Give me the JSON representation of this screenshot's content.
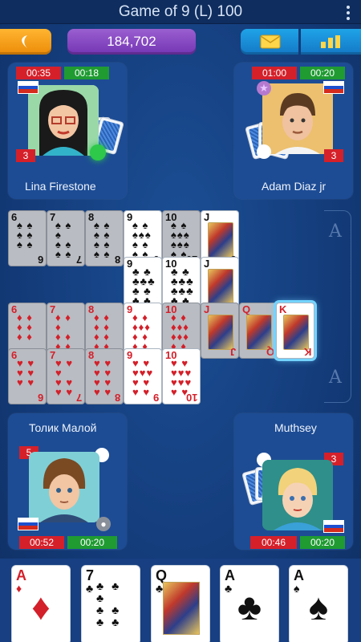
{
  "header": {
    "title": "Game of 9 (L) 100",
    "coins": "184,702"
  },
  "colors": {
    "table": "#1a4a93",
    "timer_red": "#d5202a",
    "timer_green": "#1f9b32",
    "coins": "#8048c0",
    "orange": "#f5a01c",
    "blue_button": "#1b8fdd"
  },
  "players": {
    "top_left": {
      "name": "Lina Firestone",
      "timer_left": "00:35",
      "timer_right": "00:18",
      "cards_count": "3",
      "flag": "russia-flag",
      "online": "green-dot"
    },
    "top_right": {
      "name": "Adam Diaz jr",
      "timer_left": "01:00",
      "timer_right": "00:20",
      "cards_count": "3",
      "flag": "russia-flag",
      "badge": "star-icon"
    },
    "bottom_left": {
      "name": "Толик Малой",
      "timer_left": "00:52",
      "timer_right": "00:20",
      "cards_count": "5",
      "flag": "russia-flag",
      "platform": "apple-icon"
    },
    "bottom_right": {
      "name": "Muthsey",
      "timer_left": "00:46",
      "timer_right": "00:20",
      "cards_count": "3",
      "flag": "russia-flag"
    }
  },
  "table": {
    "rows": [
      {
        "suit": "spades",
        "cards": [
          "6",
          "7",
          "8",
          "9",
          "10",
          "J"
        ]
      },
      {
        "suit": "clubs",
        "cards": [
          "9",
          "10",
          "J"
        ]
      },
      {
        "suit": "diamonds",
        "cards": [
          "6",
          "7",
          "8",
          "9",
          "10",
          "J",
          "Q",
          "K"
        ]
      },
      {
        "suit": "hearts",
        "cards": [
          "6",
          "7",
          "8",
          "9",
          "10"
        ]
      }
    ],
    "ghost_labels": [
      "A",
      "A"
    ]
  },
  "hand": [
    {
      "rank": "A",
      "suit": "♦"
    },
    {
      "rank": "7",
      "suit": "♣"
    },
    {
      "rank": "Q",
      "suit": "♣"
    },
    {
      "rank": "A",
      "suit": "♣"
    },
    {
      "rank": "A",
      "suit": "♠"
    }
  ]
}
